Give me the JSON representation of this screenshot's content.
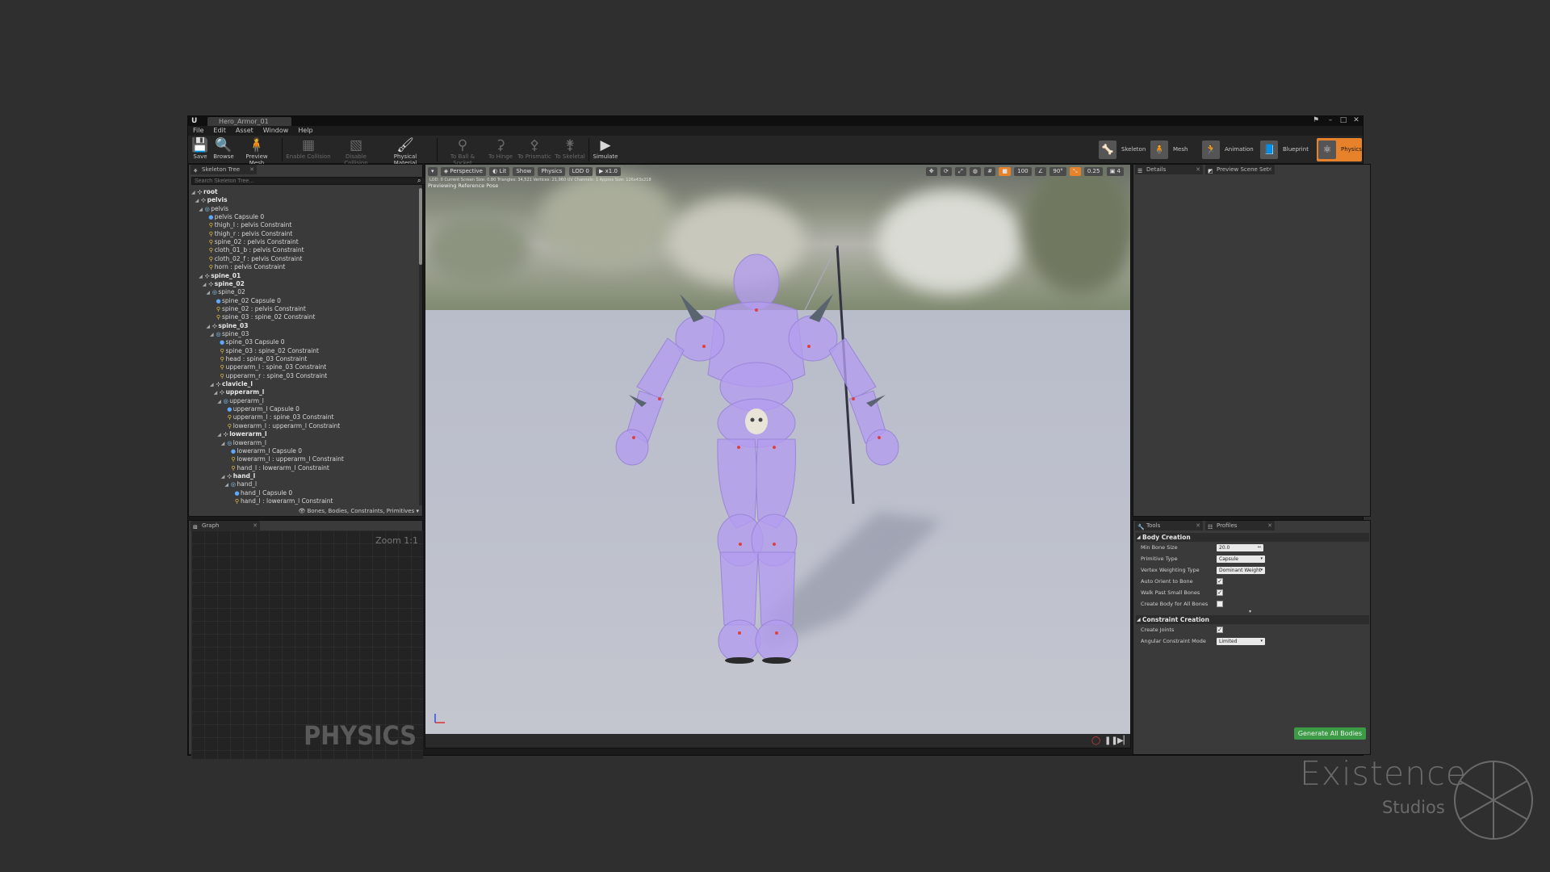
{
  "window": {
    "tab_title": "Hero_Armor_01",
    "controls": [
      "⚑",
      "–",
      "□",
      "✕"
    ]
  },
  "menu": [
    "File",
    "Edit",
    "Asset",
    "Window",
    "Help"
  ],
  "toolbar": {
    "buttons": [
      {
        "label": "Save",
        "icon": "save-icon",
        "enabled": true
      },
      {
        "label": "Browse",
        "icon": "browse-icon",
        "enabled": true
      },
      {
        "label": "Preview Mesh",
        "icon": "preview-mesh-icon",
        "enabled": true
      },
      {
        "label": "Enable Collision",
        "icon": "enable-collision-icon",
        "enabled": false
      },
      {
        "label": "Disable Collision",
        "icon": "disable-collision-icon",
        "enabled": false
      },
      {
        "label": "Physical Material",
        "icon": "physical-material-icon",
        "enabled": true
      },
      {
        "label": "To Ball & Socket",
        "icon": "ball-socket-icon",
        "enabled": false
      },
      {
        "label": "To Hinge",
        "icon": "hinge-icon",
        "enabled": false
      },
      {
        "label": "To Prismatic",
        "icon": "prismatic-icon",
        "enabled": false
      },
      {
        "label": "To Skeletal",
        "icon": "skeletal-icon",
        "enabled": false
      },
      {
        "label": "Simulate",
        "icon": "simulate-icon",
        "enabled": true
      }
    ],
    "modes": [
      {
        "label": "Skeleton",
        "active": false
      },
      {
        "label": "Mesh",
        "active": false
      },
      {
        "label": "Animation",
        "active": false
      },
      {
        "label": "Blueprint",
        "active": false
      },
      {
        "label": "Physics",
        "active": true
      }
    ]
  },
  "skeleton_tree": {
    "tab": "Skeleton Tree",
    "search_placeholder": "Search Skeleton Tree...",
    "filter_label": "Bones, Bodies, Constraints, Primitives",
    "rows": [
      {
        "d": 0,
        "t": "bone",
        "label": "root",
        "bold": true
      },
      {
        "d": 1,
        "t": "bone",
        "label": "pelvis",
        "bold": true
      },
      {
        "d": 2,
        "t": "body",
        "label": "pelvis",
        "bold": false
      },
      {
        "d": 3,
        "t": "cap",
        "label": "pelvis Capsule 0",
        "bold": false
      },
      {
        "d": 3,
        "t": "con",
        "label": "thigh_l : pelvis Constraint",
        "bold": false
      },
      {
        "d": 3,
        "t": "con",
        "label": "thigh_r : pelvis Constraint",
        "bold": false
      },
      {
        "d": 3,
        "t": "con",
        "label": "spine_02 : pelvis Constraint",
        "bold": false
      },
      {
        "d": 3,
        "t": "con",
        "label": "cloth_01_b : pelvis Constraint",
        "bold": false
      },
      {
        "d": 3,
        "t": "con",
        "label": "cloth_02_f : pelvis Constraint",
        "bold": false
      },
      {
        "d": 3,
        "t": "con",
        "label": "horn : pelvis Constraint",
        "bold": false
      },
      {
        "d": 2,
        "t": "bone",
        "label": "spine_01",
        "bold": true
      },
      {
        "d": 3,
        "t": "bone",
        "label": "spine_02",
        "bold": true
      },
      {
        "d": 4,
        "t": "body",
        "label": "spine_02",
        "bold": false
      },
      {
        "d": 5,
        "t": "cap",
        "label": "spine_02 Capsule 0",
        "bold": false
      },
      {
        "d": 5,
        "t": "con",
        "label": "spine_02 : pelvis Constraint",
        "bold": false
      },
      {
        "d": 5,
        "t": "con",
        "label": "spine_03 : spine_02 Constraint",
        "bold": false
      },
      {
        "d": 4,
        "t": "bone",
        "label": "spine_03",
        "bold": true
      },
      {
        "d": 5,
        "t": "body",
        "label": "spine_03",
        "bold": false
      },
      {
        "d": 6,
        "t": "cap",
        "label": "spine_03 Capsule 0",
        "bold": false
      },
      {
        "d": 6,
        "t": "con",
        "label": "spine_03 : spine_02 Constraint",
        "bold": false
      },
      {
        "d": 6,
        "t": "con",
        "label": "head : spine_03 Constraint",
        "bold": false
      },
      {
        "d": 6,
        "t": "con",
        "label": "upperarm_l : spine_03 Constraint",
        "bold": false
      },
      {
        "d": 6,
        "t": "con",
        "label": "upperarm_r : spine_03 Constraint",
        "bold": false
      },
      {
        "d": 5,
        "t": "bone",
        "label": "clavicle_l",
        "bold": true
      },
      {
        "d": 6,
        "t": "bone",
        "label": "upperarm_l",
        "bold": true
      },
      {
        "d": 7,
        "t": "body",
        "label": "upperarm_l",
        "bold": false
      },
      {
        "d": 8,
        "t": "cap",
        "label": "upperarm_l Capsule 0",
        "bold": false
      },
      {
        "d": 8,
        "t": "con",
        "label": "upperarm_l : spine_03 Constraint",
        "bold": false
      },
      {
        "d": 8,
        "t": "con",
        "label": "lowerarm_l : upperarm_l Constraint",
        "bold": false
      },
      {
        "d": 7,
        "t": "bone",
        "label": "lowerarm_l",
        "bold": true
      },
      {
        "d": 8,
        "t": "body",
        "label": "lowerarm_l",
        "bold": false
      },
      {
        "d": 9,
        "t": "cap",
        "label": "lowerarm_l Capsule 0",
        "bold": false
      },
      {
        "d": 9,
        "t": "con",
        "label": "lowerarm_l : upperarm_l Constraint",
        "bold": false
      },
      {
        "d": 9,
        "t": "con",
        "label": "hand_l : lowerarm_l Constraint",
        "bold": false
      },
      {
        "d": 8,
        "t": "bone",
        "label": "hand_l",
        "bold": true
      },
      {
        "d": 9,
        "t": "body",
        "label": "hand_l",
        "bold": false
      },
      {
        "d": 10,
        "t": "cap",
        "label": "hand_l Capsule 0",
        "bold": false
      },
      {
        "d": 10,
        "t": "con",
        "label": "hand_l : lowerarm_l Constraint",
        "bold": false
      }
    ]
  },
  "graph": {
    "tab": "Graph",
    "zoom": "Zoom 1:1",
    "watermark": "PHYSICS"
  },
  "viewport": {
    "buttons": [
      "Perspective",
      "Lit",
      "Show",
      "Physics",
      "LOD 0",
      "x1.0"
    ],
    "right_values": [
      "100",
      "90°",
      "0.25",
      "4"
    ],
    "info": "Previewing Reference Pose",
    "info_sub": "LOD: 0  Current Screen Size: 0.80  Triangles: 34,521  Vertices: 21,960  UV Channels: 1  Approx Size: 126x43x218"
  },
  "details": {
    "tabs": [
      "Details",
      "Preview Scene Set"
    ]
  },
  "tools": {
    "tabs": [
      "Tools",
      "Profiles"
    ],
    "body_creation": {
      "header": "Body Creation",
      "props": [
        {
          "label": "Min Bone Size",
          "kind": "number",
          "value": "20.0"
        },
        {
          "label": "Primitive Type",
          "kind": "dropdown",
          "value": "Capsule"
        },
        {
          "label": "Vertex Weighting Type",
          "kind": "dropdown",
          "value": "Dominant Weight"
        },
        {
          "label": "Auto Orient to Bone",
          "kind": "check",
          "checked": true
        },
        {
          "label": "Walk Past Small Bones",
          "kind": "check",
          "checked": true
        },
        {
          "label": "Create Body for All Bones",
          "kind": "check",
          "checked": false
        }
      ]
    },
    "constraint_creation": {
      "header": "Constraint Creation",
      "props": [
        {
          "label": "Create Joints",
          "kind": "check",
          "checked": true
        },
        {
          "label": "Angular Constraint Mode",
          "kind": "dropdown",
          "value": "Limited"
        }
      ]
    },
    "generate_button": "Generate All Bodies"
  },
  "brand": {
    "name": "Existence",
    "sub": "Studios"
  },
  "colors": {
    "accent": "#e8822a",
    "generate": "#3b9c45",
    "physics_body": "#b49cf0"
  }
}
